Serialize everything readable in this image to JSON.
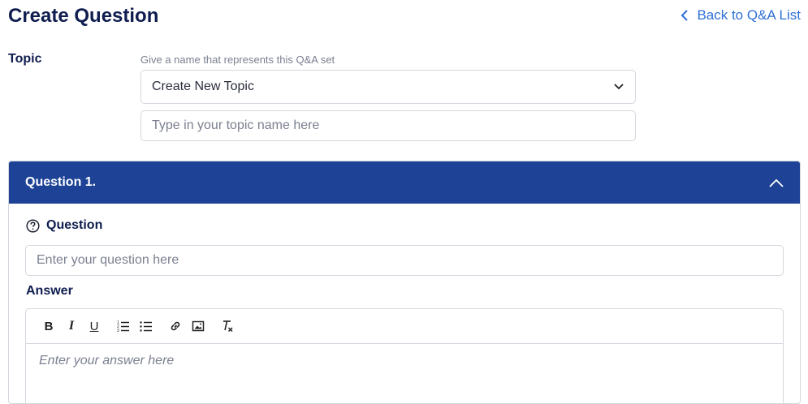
{
  "header": {
    "title": "Create Question",
    "back_link": "Back to Q&A List"
  },
  "topic": {
    "label": "Topic",
    "hint": "Give a name that represents this Q&A set",
    "select_value": "Create New Topic",
    "input_placeholder": "Type in your topic name here"
  },
  "question_card": {
    "title": "Question 1.",
    "question_label": "Question",
    "question_placeholder": "Enter your question here",
    "answer_label": "Answer",
    "answer_placeholder": "Enter your answer here",
    "toolbar": {
      "bold": "B",
      "italic": "I",
      "underline": "U"
    }
  },
  "colors": {
    "header_bg": "#1e4396",
    "title_text": "#0f1d4f",
    "link": "#2e6fd6"
  }
}
